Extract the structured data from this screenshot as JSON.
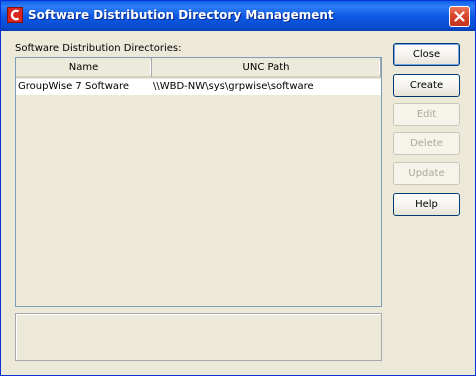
{
  "window": {
    "title": "Software Distribution Directory Management",
    "app_icon": "groupwise-c-icon",
    "close_icon": "close-icon"
  },
  "directories": {
    "label": "Software Distribution Directories:",
    "columns": [
      "Name",
      "UNC Path"
    ],
    "rows": [
      {
        "name": "GroupWise 7 Software",
        "unc_path": "\\\\WBD-NW\\sys\\grpwise\\software"
      }
    ]
  },
  "buttons": {
    "close": {
      "label": "Close",
      "enabled": true,
      "default": true
    },
    "create": {
      "label": "Create",
      "enabled": true
    },
    "edit": {
      "label": "Edit",
      "enabled": false
    },
    "delete": {
      "label": "Delete",
      "enabled": false
    },
    "update": {
      "label": "Update",
      "enabled": false
    },
    "help": {
      "label": "Help",
      "enabled": true
    }
  },
  "status": {
    "text": ""
  },
  "colors": {
    "titlebar": "#0a5fe8",
    "dialog_bg": "#ece9d8",
    "close_button": "#d9462b",
    "disabled_text": "#aca899"
  }
}
